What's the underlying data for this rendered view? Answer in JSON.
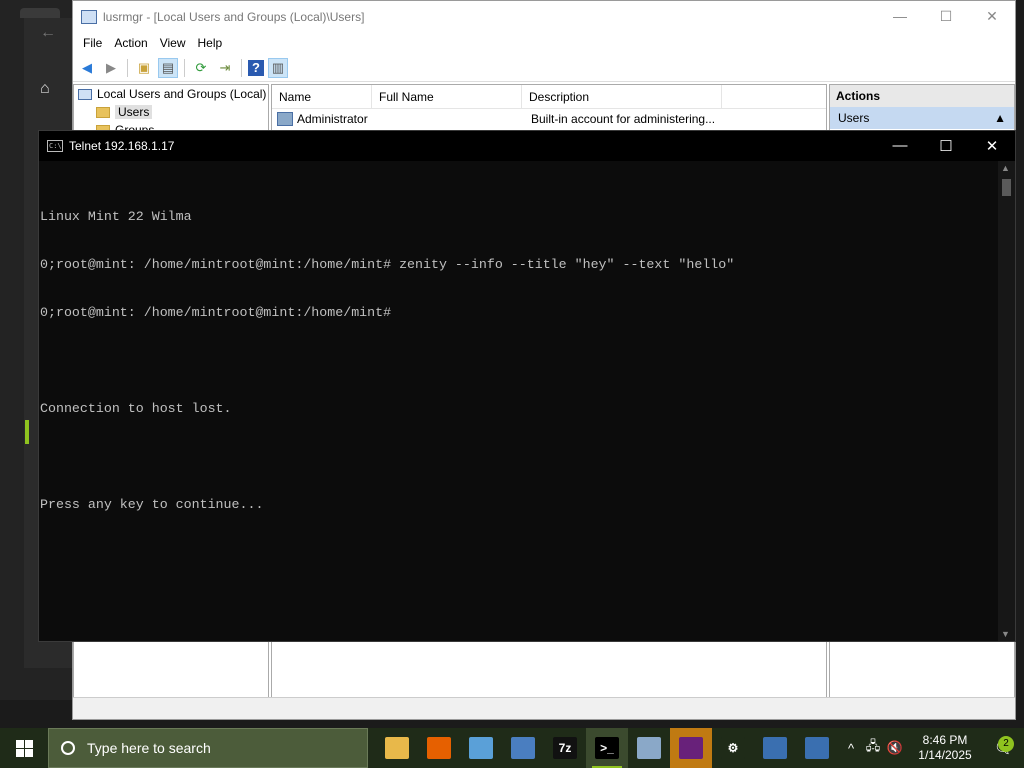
{
  "lusrmgr": {
    "title": "lusrmgr - [Local Users and Groups (Local)\\Users]",
    "caption": {
      "minimize": "—",
      "maximize": "☐",
      "close": "✕"
    },
    "menu": [
      "File",
      "Action",
      "View",
      "Help"
    ],
    "tree": {
      "root": "Local Users and Groups (Local)",
      "users": "Users",
      "groups": "Groups"
    },
    "columns": {
      "name": "Name",
      "full_name": "Full Name",
      "description": "Description"
    },
    "rows": [
      {
        "name": "Administrator",
        "full_name": "",
        "description": "Built-in account for administering..."
      }
    ],
    "actions": {
      "header": "Actions",
      "section": "Users",
      "collapse_glyph": "▲"
    }
  },
  "telnet": {
    "title": "Telnet 192.168.1.17",
    "caption": {
      "minimize": "—",
      "maximize": "☐",
      "close": "✕"
    },
    "lines": [
      "Linux Mint 22 Wilma",
      "0;root@mint: /home/mintroot@mint:/home/mint# zenity --info --title \"hey\" --text \"hello\"",
      "0;root@mint: /home/mintroot@mint:/home/mint#",
      "",
      "Connection to host lost.",
      "",
      "Press any key to continue..."
    ]
  },
  "taskbar": {
    "search_placeholder": "Type here to search",
    "apps": [
      {
        "name": "file-explorer-icon",
        "label": "",
        "color": "#e8b84a"
      },
      {
        "name": "firefox-icon",
        "label": "",
        "color": "#e66000"
      },
      {
        "name": "notepad-icon",
        "label": "",
        "color": "#5aa0d8"
      },
      {
        "name": "network-computer-icon",
        "label": "",
        "color": "#4a7ec0"
      },
      {
        "name": "7zip-icon",
        "label": "7z",
        "color": "#111111"
      },
      {
        "name": "console-icon",
        "label": ">_",
        "color": "#000000"
      },
      {
        "name": "remote-desktop-icon",
        "label": "",
        "color": "#8aa8c8"
      },
      {
        "name": "visual-studio-icon",
        "label": "",
        "color": "#68217a"
      },
      {
        "name": "settings-gear-icon",
        "label": "⚙",
        "color": "#1f2b18"
      },
      {
        "name": "network-manager-icon",
        "label": "",
        "color": "#3a6fb0"
      },
      {
        "name": "users-computer-icon",
        "label": "",
        "color": "#3a6fb0"
      }
    ],
    "tray": {
      "chevron": "^",
      "network": "🖧",
      "volume": "🔇"
    },
    "time": "8:46 PM",
    "date": "1/14/2025",
    "notifications": "2"
  }
}
